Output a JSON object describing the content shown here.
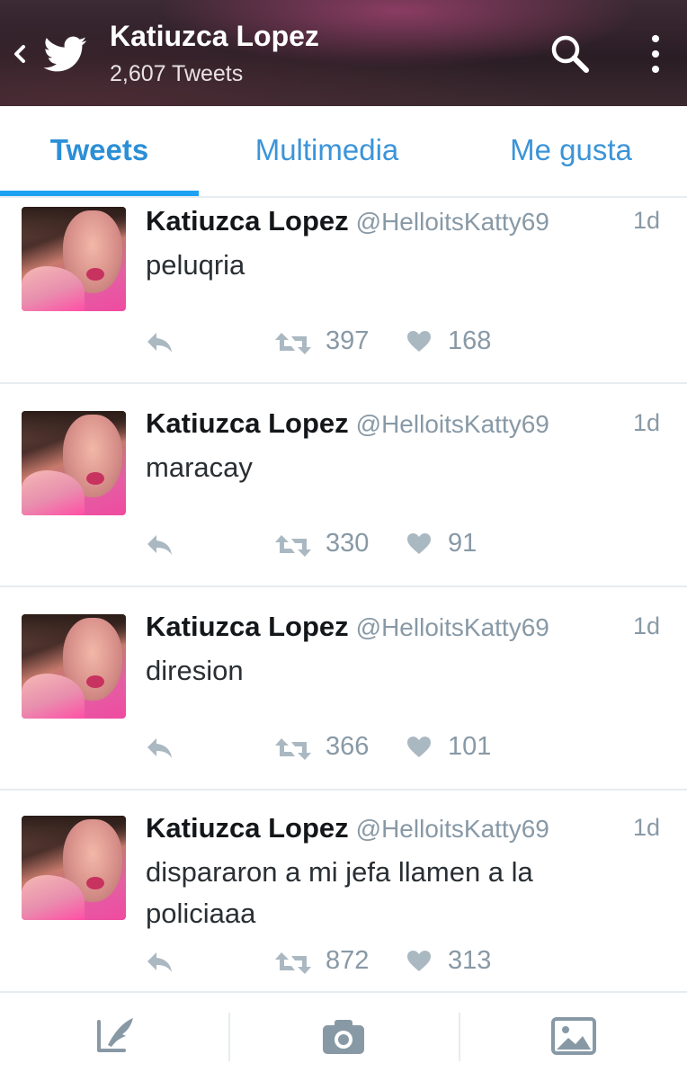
{
  "header": {
    "name": "Katiuzca Lopez",
    "tweet_count": "2,607 Tweets",
    "icons": [
      "back-chevron-icon",
      "twitter-bird-icon",
      "search-icon",
      "more-vertical-icon"
    ]
  },
  "tabs": [
    {
      "label": "Tweets",
      "active": true
    },
    {
      "label": "Multimedia",
      "active": false
    },
    {
      "label": "Me gusta",
      "active": false
    }
  ],
  "colors": {
    "accent": "#1da1f2",
    "tab_text": "#3b94d9",
    "muted": "#8899a6",
    "text": "#14171a"
  },
  "tweets": [
    {
      "name": "Katiuzca Lopez",
      "handle": "@HelloitsKatty69",
      "time": "1d",
      "text": "peluqria",
      "retweets": "397",
      "likes": "168"
    },
    {
      "name": "Katiuzca Lopez",
      "handle": "@HelloitsKatty69",
      "time": "1d",
      "text": "maracay",
      "retweets": "330",
      "likes": "91"
    },
    {
      "name": "Katiuzca Lopez",
      "handle": "@HelloitsKatty69",
      "time": "1d",
      "text": "diresion",
      "retweets": "366",
      "likes": "101"
    },
    {
      "name": "Katiuzca Lopez",
      "handle": "@HelloitsKatty69",
      "time": "1d",
      "text": "dispararon a mi jefa llamen a la policiaaa",
      "retweets": "872",
      "likes": "313"
    }
  ],
  "bottom_bar": {
    "icons": [
      "compose-tweet-icon",
      "camera-icon",
      "image-icon"
    ]
  }
}
